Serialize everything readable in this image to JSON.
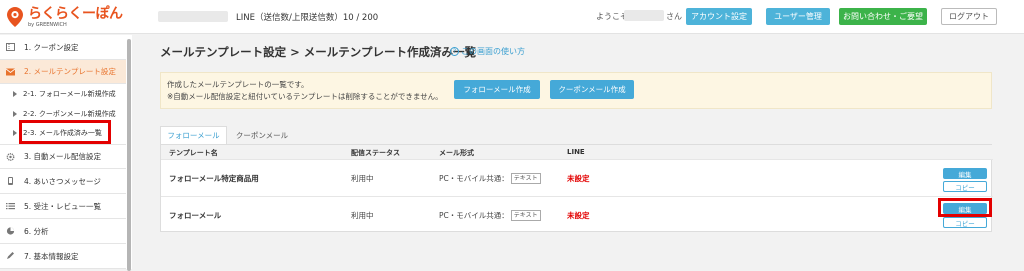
{
  "header": {
    "logo_text": "らくらくーぽん",
    "logo_sub": "by GREENWICH",
    "line_usage": "LINE（送信数/上限送信数）10 / 200",
    "welcome_prefix": "ようこそ、",
    "welcome_suffix": "さん",
    "buttons": {
      "account": "アカウント設定",
      "users": "ユーザー管理",
      "contact": "お問い合わせ・ご要望",
      "logout": "ログアウト"
    }
  },
  "sidebar": {
    "items": [
      {
        "label": "1. クーポン設定",
        "icon": "coupon-icon"
      },
      {
        "label": "2. メールテンプレート設定",
        "icon": "mail-icon",
        "active": true
      },
      {
        "label": "3. 自動メール配信設定",
        "icon": "gear-icon"
      },
      {
        "label": "4. あいさつメッセージ",
        "icon": "phone-icon"
      },
      {
        "label": "5. 受注・レビュー一覧",
        "icon": "list-icon"
      },
      {
        "label": "6. 分析",
        "icon": "pie-chart-icon"
      },
      {
        "label": "7. 基本情報設定",
        "icon": "pencil-icon"
      }
    ],
    "subitems": [
      {
        "label": "2-1. フォローメール新規作成"
      },
      {
        "label": "2-2. クーポンメール新規作成"
      },
      {
        "label": "2-3. メール作成済み一覧",
        "highlighted": true
      }
    ]
  },
  "main": {
    "title": "メールテンプレート設定 > メールテンプレート作成済み一覧",
    "help_link": "この画面の使い方",
    "notice": {
      "line1": "作成したメールテンプレートの一覧です。",
      "line2": "※自動メール配信設定と紐付いているテンプレートは削除することができません。",
      "btn_follow": "フォローメール作成",
      "btn_coupon": "クーポンメール作成"
    },
    "tabs": [
      {
        "label": "フォローメール",
        "active": true
      },
      {
        "label": "クーポンメール",
        "active": false
      }
    ],
    "table": {
      "columns": [
        "テンプレート名",
        "配信ステータス",
        "メール形式",
        "LINE"
      ],
      "rows": [
        {
          "name": "フォローメール特定商品用",
          "status": "利用中",
          "format": "PC・モバイル共通：",
          "format_tag": "テキスト",
          "line": "未設定",
          "edit": "編集",
          "copy": "コピー"
        },
        {
          "name": "フォローメール",
          "status": "利用中",
          "format": "PC・モバイル共通：",
          "format_tag": "テキスト",
          "line": "未設定",
          "edit": "編集",
          "copy": "コピー",
          "edit_highlighted": true
        }
      ]
    }
  },
  "colors": {
    "accent_orange": "#e8732d",
    "button_blue": "#45a9d8",
    "button_green": "#3cb34a",
    "highlight_red": "#e30000"
  }
}
